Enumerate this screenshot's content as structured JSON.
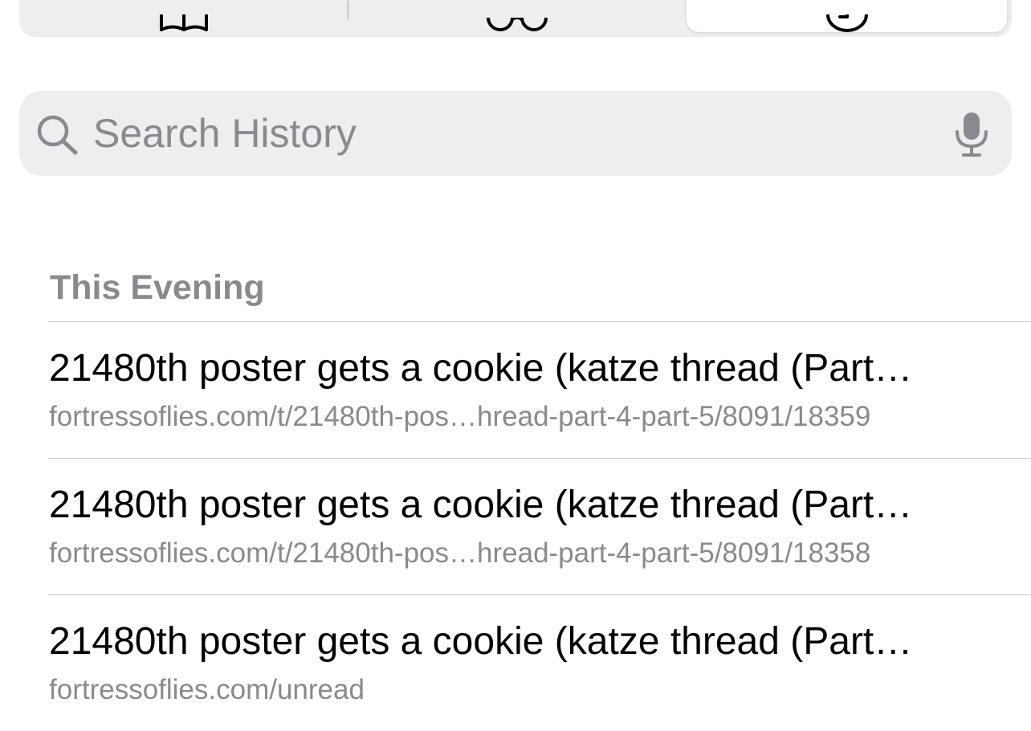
{
  "segmented_control": {
    "tabs": [
      {
        "icon": "book-icon",
        "selected": false
      },
      {
        "icon": "glasses-icon",
        "selected": false
      },
      {
        "icon": "clock-icon",
        "selected": true
      }
    ]
  },
  "search": {
    "placeholder": "Search History",
    "value": "",
    "icon": "search-icon",
    "mic_icon": "microphone-icon"
  },
  "history": {
    "section_title": "This Evening",
    "items": [
      {
        "title": "21480th poster gets a cookie (katze thread (Part…",
        "url": "fortressoflies.com/t/21480th-pos…hread-part-4-part-5/8091/18359"
      },
      {
        "title": "21480th poster gets a cookie (katze thread (Part…",
        "url": "fortressoflies.com/t/21480th-pos…hread-part-4-part-5/8091/18358"
      },
      {
        "title": "21480th poster gets a cookie (katze thread (Part…",
        "url": "fortressoflies.com/unread"
      }
    ]
  },
  "colors": {
    "secondary_text": "#8a8a8e",
    "fill": "#eeeeef",
    "separator": "#c8c8cc"
  }
}
